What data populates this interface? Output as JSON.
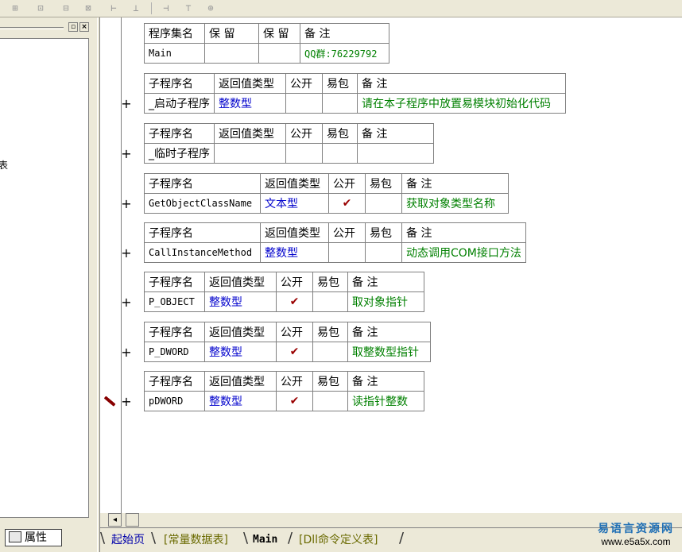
{
  "toolbar": {
    "icons": [
      "layout-a-icon",
      "layout-b-icon",
      "layout-c-icon",
      "layout-d-icon",
      "align-width-icon",
      "align-height-icon",
      "size-width-icon",
      "size-height-icon",
      "size-both-icon"
    ],
    "glyphs": [
      "⊞",
      "⊡",
      "⊟",
      "⊠",
      "⊢",
      "⊥",
      "⊣",
      "⊤",
      "⊕"
    ]
  },
  "left_panel": {
    "truncated_text": "表",
    "property_tab": "属性"
  },
  "assembly": {
    "headers": [
      "程序集名",
      "保 留",
      "保 留",
      "备 注"
    ],
    "name": "Main",
    "remark": "QQ群:76229792"
  },
  "subroutines": [
    {
      "headers": [
        "子程序名",
        "返回值类型",
        "公开",
        "易包",
        "备 注"
      ],
      "name": "_启动子程序",
      "name_mono": false,
      "ret": "整数型",
      "public": "",
      "remark": "请在本子程序中放置易模块初始化代码",
      "plus": "+"
    },
    {
      "headers": [
        "子程序名",
        "返回值类型",
        "公开",
        "易包",
        "备 注"
      ],
      "name": "_临时子程序",
      "name_mono": false,
      "ret": "",
      "public": "",
      "remark": "",
      "plus": "+"
    },
    {
      "headers": [
        "子程序名",
        "返回值类型",
        "公开",
        "易包",
        "备 注"
      ],
      "name": "GetObjectClassName",
      "name_mono": true,
      "ret": "文本型",
      "public": "✔",
      "remark": "获取对象类型名称",
      "plus": "+"
    },
    {
      "headers": [
        "子程序名",
        "返回值类型",
        "公开",
        "易包",
        "备 注"
      ],
      "name": "CallInstanceMethod",
      "name_mono": true,
      "ret": "整数型",
      "public": "",
      "remark": "动态调用COM接口方法",
      "plus": "+"
    },
    {
      "headers": [
        "子程序名",
        "返回值类型",
        "公开",
        "易包",
        "备 注"
      ],
      "name": "P_OBJECT",
      "name_mono": true,
      "ret": "整数型",
      "public": "✔",
      "remark": "取对象指针",
      "plus": "+"
    },
    {
      "headers": [
        "子程序名",
        "返回值类型",
        "公开",
        "易包",
        "备 注"
      ],
      "name": "P_DWORD",
      "name_mono": true,
      "ret": "整数型",
      "public": "✔",
      "remark": "取整数型指针",
      "plus": "+"
    },
    {
      "headers": [
        "子程序名",
        "返回值类型",
        "公开",
        "易包",
        "备 注"
      ],
      "name": "pDWORD",
      "name_mono": true,
      "ret": "整数型",
      "public": "✔",
      "remark": "读指针整数",
      "plus": "+"
    }
  ],
  "tabs": {
    "start": "起始页",
    "constants": "[常量数据表]",
    "main": "Main",
    "dll": "[Dll命令定义表]"
  },
  "watermark": {
    "line1": "易语言资源网",
    "line2": "www.e5a5x.com"
  },
  "colors": {
    "type_blue": "#0000cc",
    "remark_green": "#008000",
    "check_red": "#990000",
    "pencil_red": "#880000"
  }
}
